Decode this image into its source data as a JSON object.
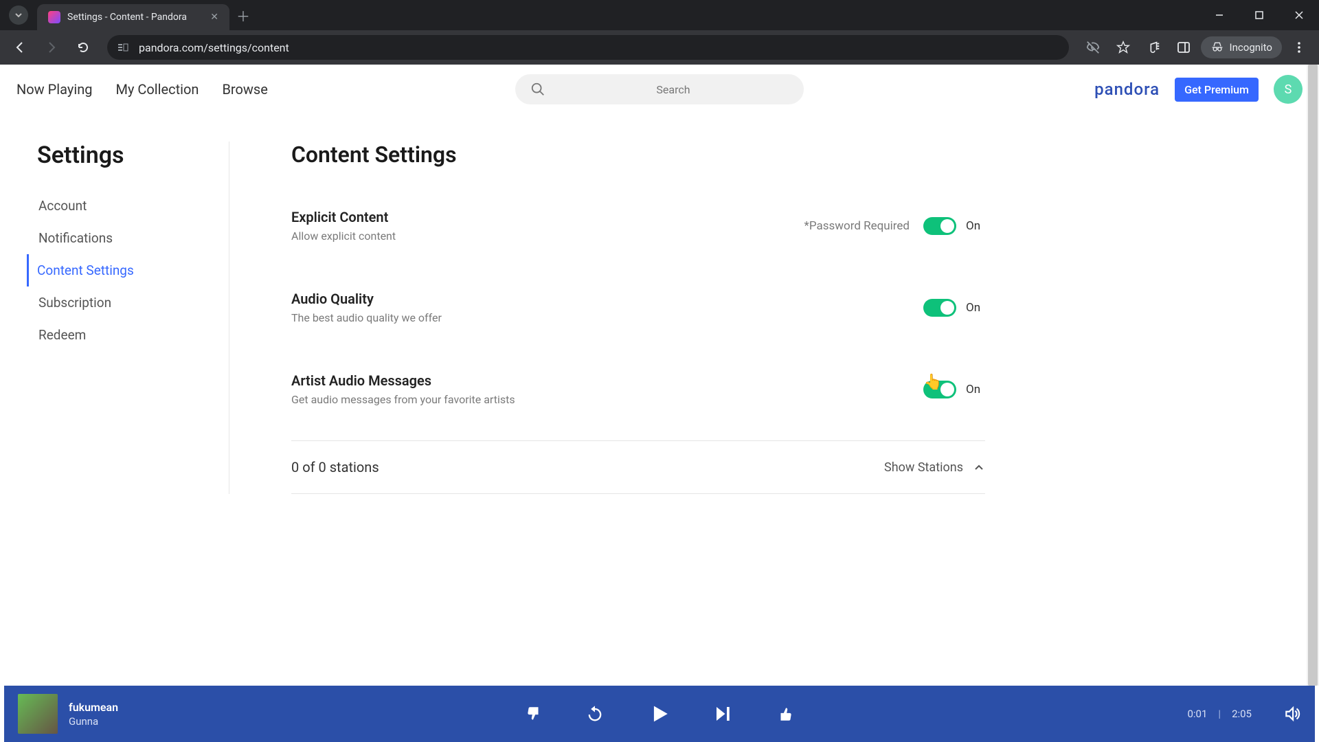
{
  "browser": {
    "tab_title": "Settings - Content - Pandora",
    "url": "pandora.com/settings/content",
    "incognito_label": "Incognito"
  },
  "nav": {
    "now_playing": "Now Playing",
    "my_collection": "My Collection",
    "browse": "Browse",
    "search_placeholder": "Search",
    "brand": "pandora",
    "premium": "Get Premium",
    "avatar_initial": "S"
  },
  "sidebar": {
    "title": "Settings",
    "items": [
      "Account",
      "Notifications",
      "Content Settings",
      "Subscription",
      "Redeem"
    ],
    "active_index": 2
  },
  "main": {
    "heading": "Content Settings",
    "settings": [
      {
        "title": "Explicit Content",
        "desc": "Allow explicit content",
        "note": "*Password Required",
        "state": "On"
      },
      {
        "title": "Audio Quality",
        "desc": "The best audio quality we offer",
        "note": "",
        "state": "On"
      },
      {
        "title": "Artist Audio Messages",
        "desc": "Get audio messages from your favorite artists",
        "note": "",
        "state": "On"
      }
    ],
    "stations_count": "0 of 0 stations",
    "show_stations": "Show Stations"
  },
  "player": {
    "track": "fukumean",
    "artist": "Gunna",
    "elapsed": "0:01",
    "duration": "2:05"
  }
}
